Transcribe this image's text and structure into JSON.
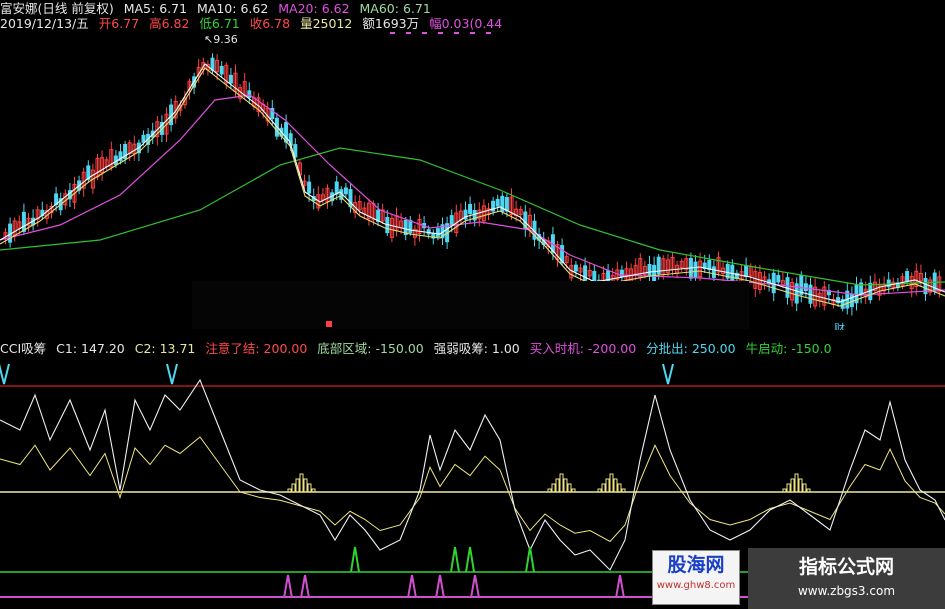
{
  "price_header": {
    "stock": "富安娜(日线 前复权)",
    "ma5": "MA5: 6.71",
    "ma10": "MA10: 6.62",
    "ma20": "MA20: 6.62",
    "ma60": "MA60: 6.71",
    "date": "2019/12/13/五",
    "open": "开6.77",
    "high": "高6.82",
    "low": "低6.71",
    "close": "收6.78",
    "volume": "量25012",
    "amount": "额1693万",
    "change": "幅0.03(0.44"
  },
  "peak_label": "9.36",
  "marker_cai": "财",
  "indicator_header": {
    "name": "CCI吸筹",
    "c1": "C1: 147.20",
    "c2": "C2: 13.71",
    "zhuyi": "注意了结: 200.00",
    "dibu": "底部区域: -150.00",
    "qiangruo": "强弱吸筹: 1.00",
    "mairu": "买入时机: -200.00",
    "fenpi": "分批出: 250.00",
    "niu": "牛启动: -150.0"
  },
  "watermark_left": {
    "title": "股海网",
    "url": "www.ghw8.com"
  },
  "watermark_right": {
    "title": "指标公式网",
    "url": "www.zbgs3.com"
  },
  "colors": {
    "up": "#ff4040",
    "down": "#4fd6f0",
    "ma5": "#ffffff",
    "ma10": "#e8e070",
    "ma20": "#e050e0",
    "ma60": "#31c031",
    "cci": "#f0f0f0",
    "cci_slow": "#f0e680",
    "level_200": "#d02020",
    "level_zero": "#f0e8a0",
    "level_green": "#31d331",
    "level_magenta": "#d050d0"
  },
  "icons": [
    "down-arrow-marker-icon",
    "buy-signal-peak-icon"
  ]
}
